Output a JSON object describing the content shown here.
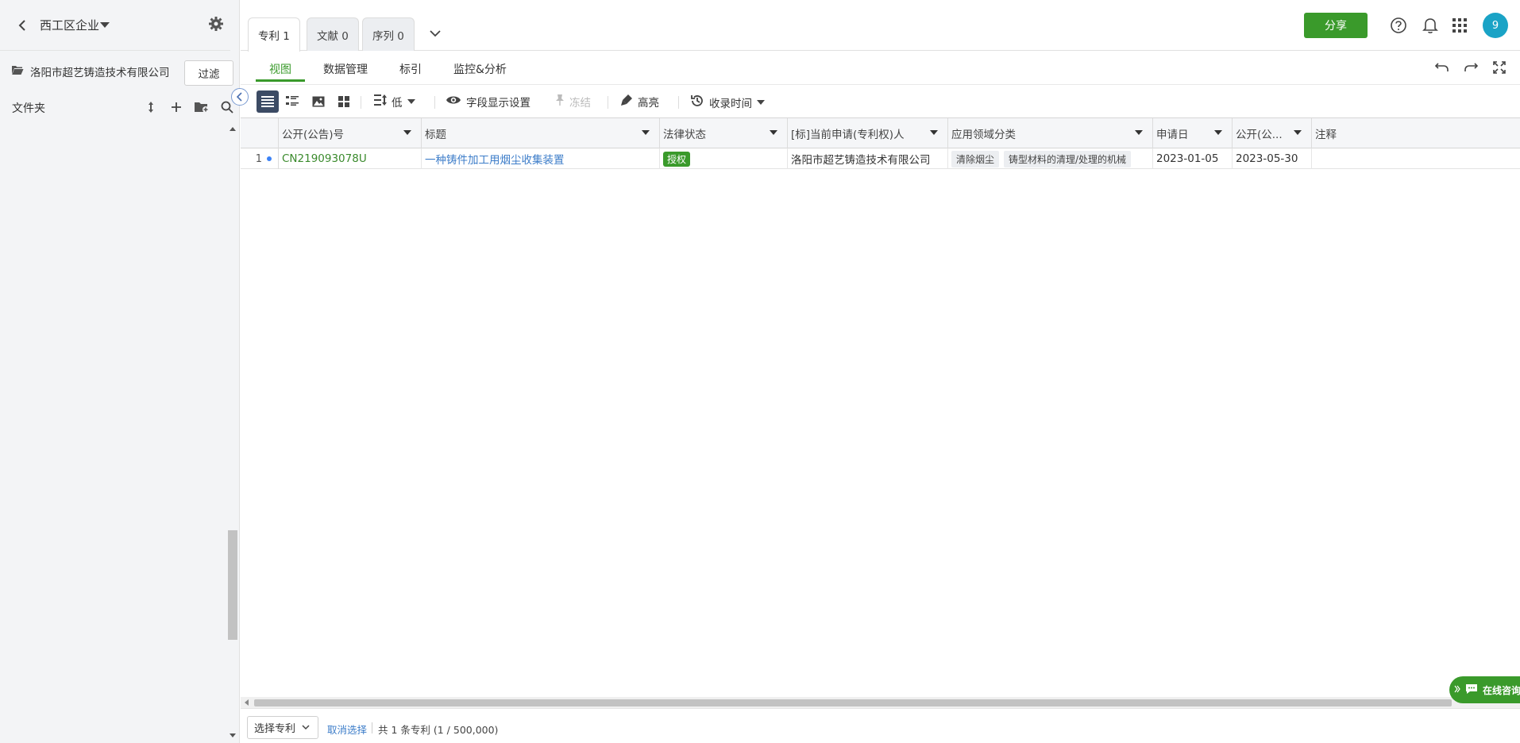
{
  "sidebar": {
    "title": "西工区企业",
    "company": "洛阳市超艺铸造技术有限公司",
    "filter_label": "过滤",
    "folder_label": "文件夹"
  },
  "tabs": [
    {
      "label": "专利 1"
    },
    {
      "label": "文献 0"
    },
    {
      "label": "序列 0"
    }
  ],
  "header": {
    "share_label": "分享",
    "avatar_text": "9"
  },
  "subnav": {
    "items": [
      "视图",
      "数据管理",
      "标引",
      "监控&分析"
    ]
  },
  "toolbar": {
    "density_label": "低",
    "field_settings_label": "字段显示设置",
    "freeze_label": "冻结",
    "highlight_label": "高亮",
    "collect_time_label": "收录时间"
  },
  "table": {
    "columns": [
      "公开(公告)号",
      "标题",
      "法律状态",
      "[标]当前申请(专利权)人",
      "应用领域分类",
      "申请日",
      "公开(公...",
      "注释"
    ],
    "rows": [
      {
        "index": "1",
        "publication_no": "CN219093078U",
        "title": "一种铸件加工用烟尘收集装置",
        "legal_status": "授权",
        "applicant": "洛阳市超艺铸造技术有限公司",
        "fields": [
          "清除烟尘",
          "铸型材料的清理/处理的机械"
        ],
        "apply_date": "2023-01-05",
        "pub_date": "2023-05-30",
        "note": ""
      }
    ]
  },
  "footer": {
    "select_label": "选择专利",
    "cancel_label": "取消选择",
    "count_text": "共 1 条专利 (1 / 500,000)"
  },
  "chat": {
    "label": "在线咨询"
  },
  "colors": {
    "brand_green": "#3a9a2b",
    "link_blue": "#3d7dc9",
    "avatar": "#1aa3c6"
  }
}
